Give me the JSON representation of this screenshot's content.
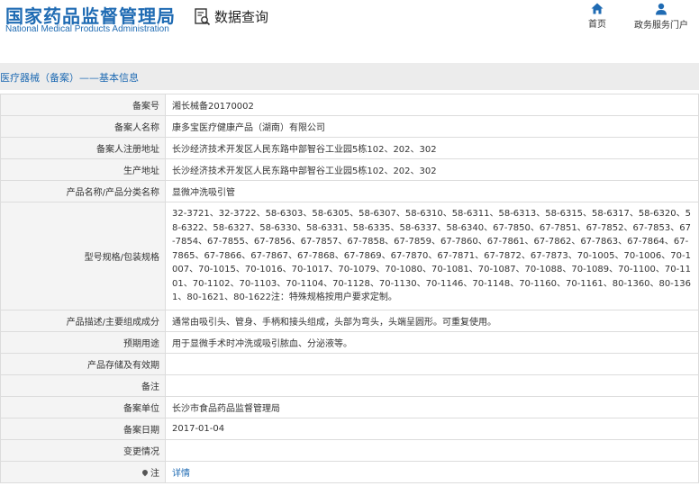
{
  "header": {
    "org_name_cn": "国家药品监督管理局",
    "org_name_en": "National Medical Products Administration",
    "query_label": "数据查询",
    "nav": [
      {
        "label": "首页",
        "icon": "home-icon"
      },
      {
        "label": "政务服务门户",
        "icon": "user-icon"
      }
    ]
  },
  "page": {
    "title": "医疗器械（备案）——基本信息"
  },
  "fields": [
    {
      "label": "备案号",
      "value": "湘长械备20170002"
    },
    {
      "label": "备案人名称",
      "value": "康多宝医疗健康产品（湖南）有限公司"
    },
    {
      "label": "备案人注册地址",
      "value": "长沙经济技术开发区人民东路中部智谷工业园5栋102、202、302"
    },
    {
      "label": "生产地址",
      "value": "长沙经济技术开发区人民东路中部智谷工业园5栋102、202、302"
    },
    {
      "label": "产品名称/产品分类名称",
      "value": "显微冲洗吸引管"
    },
    {
      "label": "型号规格/包装规格",
      "value": "32-3721、32-3722、58-6303、58-6305、58-6307、58-6310、58-6311、58-6313、58-6315、58-6317、58-6320、58-6322、58-6327、58-6330、58-6331、58-6335、58-6337、58-6340、67-7850、67-7851、67-7852、67-7853、67-7854、67-7855、67-7856、67-7857、67-7858、67-7859、67-7860、67-7861、67-7862、67-7863、67-7864、67-7865、67-7866、67-7867、67-7868、67-7869、67-7870、67-7871、67-7872、67-7873、70-1005、70-1006、70-1007、70-1015、70-1016、70-1017、70-1079、70-1080、70-1081、70-1087、70-1088、70-1089、70-1100、70-1101、70-1102、70-1103、70-1104、70-1128、70-1130、70-1146、70-1148、70-1160、70-1161、80-1360、80-1361、80-1621、80-1622注：特殊规格按用户要求定制。"
    },
    {
      "label": "产品描述/主要组成成分",
      "value": "通常由吸引头、管身、手柄和接头组成，头部为弯头，头端呈圆形。可重复使用。"
    },
    {
      "label": "预期用途",
      "value": "用于显微手术时冲洗或吸引脓血、分泌液等。"
    },
    {
      "label": "产品存储及有效期",
      "value": ""
    },
    {
      "label": "备注",
      "value": ""
    },
    {
      "label": "备案单位",
      "value": "长沙市食品药品监督管理局"
    },
    {
      "label": "备案日期",
      "value": "2017-01-04"
    },
    {
      "label": "变更情况",
      "value": ""
    },
    {
      "label": "注",
      "value": "详情"
    }
  ],
  "colors": {
    "brand": "#1f6bb3",
    "link": "#1f6bb3"
  }
}
